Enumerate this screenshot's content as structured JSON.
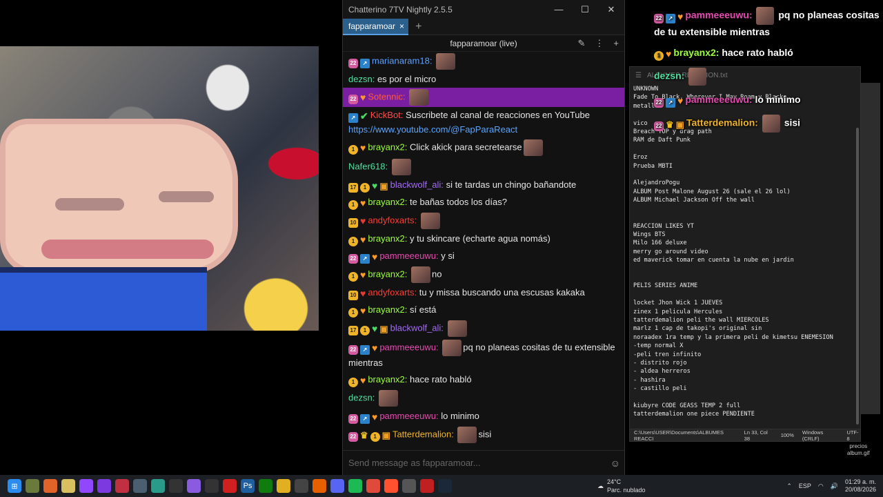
{
  "window_title": "Chatterino 7TV Nightly 2.5.5",
  "window_controls": {
    "minimize": "—",
    "maximize": "☐",
    "close": "✕"
  },
  "tab": {
    "label": "fapparamoar",
    "close": "×",
    "add": "+"
  },
  "channel_header": "fapparamoar (live)",
  "input_placeholder": "Send message as fapparamoar...",
  "messages": [
    {
      "user": "marianaram18",
      "color": "#5ea0ff",
      "badges": [
        "22",
        "arrow"
      ],
      "text": "",
      "emote": true
    },
    {
      "user": "dezsn",
      "color": "#4fe0a0",
      "badges": [],
      "text": "es por el micro"
    },
    {
      "user": "Sotennic",
      "color": "#ff5a3a",
      "badges": [
        "22",
        "heart"
      ],
      "text": "",
      "emote": true,
      "highlight": true
    },
    {
      "user": "KickBot",
      "color": "#ff4a4a",
      "badges": [
        "arrow",
        "check"
      ],
      "text": "Suscribete al canal de reacciones en YouTube",
      "link": "https://www.youtube.com/@FapParaReact"
    },
    {
      "user": "brayanx2",
      "color": "#9bff3a",
      "badges": [
        "1",
        "heart"
      ],
      "text": "Click akick para secretearse",
      "emote_after": true
    },
    {
      "user": "Nafer618",
      "color": "#4fe0a0",
      "badges": [],
      "text": "",
      "emote": true
    },
    {
      "user": "blackwolf_ali",
      "color": "#a66bff",
      "badges": [
        "17",
        "1",
        "green",
        "gift"
      ],
      "text": "si te tardas un chingo bañandote"
    },
    {
      "user": "brayanx2",
      "color": "#9bff3a",
      "badges": [
        "1",
        "heart"
      ],
      "text": "te bañas todos los días?"
    },
    {
      "user": "andyfoxarts",
      "color": "#ff3b30",
      "badges": [
        "10",
        "redheart"
      ],
      "text": "",
      "emote": true
    },
    {
      "user": "brayanx2",
      "color": "#9bff3a",
      "badges": [
        "1",
        "heart"
      ],
      "text": "y tu skincare (echarte agua nomás)"
    },
    {
      "user": "pammeeeuwu",
      "color": "#e64ab0",
      "badges": [
        "22",
        "arrow",
        "heart"
      ],
      "text": "y si"
    },
    {
      "user": "brayanx2",
      "color": "#9bff3a",
      "badges": [
        "1",
        "heart"
      ],
      "text": "no",
      "emote": true
    },
    {
      "user": "andyfoxarts",
      "color": "#ff3b30",
      "badges": [
        "10",
        "redheart"
      ],
      "text": "tu y missa buscando una escusas kakaka"
    },
    {
      "user": "brayanx2",
      "color": "#9bff3a",
      "badges": [
        "1",
        "heart"
      ],
      "text": "sí está"
    },
    {
      "user": "blackwolf_ali",
      "color": "#a66bff",
      "badges": [
        "17",
        "1",
        "green",
        "gift"
      ],
      "text": "",
      "emote": true
    },
    {
      "user": "pammeeeuwu",
      "color": "#e64ab0",
      "badges": [
        "22",
        "arrow",
        "heart"
      ],
      "text": "pq no planeas cositas de tu extensible mientras",
      "emote": true
    },
    {
      "user": "brayanx2",
      "color": "#9bff3a",
      "badges": [
        "1",
        "heart"
      ],
      "text": "hace rato habló"
    },
    {
      "user": "dezsn",
      "color": "#4fe0a0",
      "badges": [],
      "text": "",
      "emote": true
    },
    {
      "user": "pammeeeuwu",
      "color": "#e64ab0",
      "badges": [
        "22",
        "arrow",
        "heart"
      ],
      "text": "lo minimo"
    },
    {
      "user": "Tatterdemalion",
      "color": "#f0b429",
      "badges": [
        "22",
        "crown",
        "1",
        "gift"
      ],
      "text": "sisi",
      "emote": true
    }
  ],
  "notepad": {
    "title": "ALBUMES REACCION.txt",
    "lines": "UNKNOWN\nFade To Black, Wherever I May Roam y Blacke\nmetall\n\nvico\nBreach TOP y drag path\nRAM de Daft Punk\n\nEroz\nPrueba MBTI\n\nAlejandroPogu\nALBUM Post Malone August 26 (sale el 26 lol)\nALBUM Michael Jackson Off the wall\n\n\nREACCION LIKES YT\nWings BTS\nMilo 166 deluxe\nmerry go around video\ned maverick tomar en cuenta la nube en jardin\n\n\nPELIS SERIES ANIME\n\nlocket Jhon Wick 1 JUEVES\nzinex 1 pelicula Hercules\ntatterdemalion peli the wall MIERCOLES\nmarlz 1 cap de takopi's original sin\nnoraadex 1ra temp y la primera peli de kimetsu ENEMESION\n-temp normal X\n-peli tren infinito\n- distrito rojo\n- aldea herreros\n- hashira\n- castillo peli\n\nkiubyre CODE GEASS TEMP 2 full\ntatterdemalion one piece PENDIENTE",
    "status": {
      "path": "C:\\Users\\USER\\Documents\\ALBUMES REACCI",
      "pos": "Ln 33, Col 38",
      "zoom": "100%",
      "eol": "Windows (CRLF)",
      "enc": "UTF-8"
    }
  },
  "overlay": [
    {
      "user": "pammeeeuwu:",
      "color": "#e64ab0",
      "badges": [
        "22",
        "arrow",
        "heart"
      ],
      "text": "pq no planeas cositas de tu extensible mientras",
      "emote": true
    },
    {
      "user": "brayanx2:",
      "color": "#9bff3a",
      "badges": [
        "1",
        "heart"
      ],
      "text": "hace rato habló"
    },
    {
      "user": "dezsn:",
      "color": "#4fe0a0",
      "badges": [],
      "text": "",
      "emote": true
    },
    {
      "user": "pammeeeuwu:",
      "color": "#e64ab0",
      "badges": [
        "22",
        "arrow",
        "heart"
      ],
      "text": "lo minimo"
    },
    {
      "user": "Tatterdemalion:",
      "color": "#f0b429",
      "badges": [
        "22",
        "crown",
        "gift"
      ],
      "text": "sisi",
      "emote": true
    }
  ],
  "side_file": {
    "name1": "precios",
    "name2": "album.gif"
  },
  "taskbar": {
    "weather_temp": "24°C",
    "weather_desc": "Parc. nublado",
    "lang": "ESP",
    "time": "01:29 a. m.",
    "date": "20/08/2026"
  }
}
